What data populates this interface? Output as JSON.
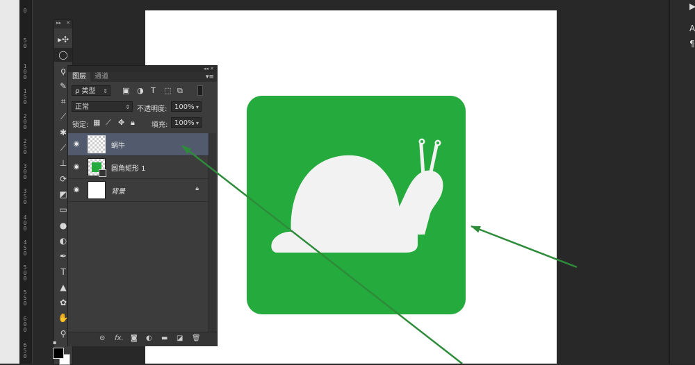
{
  "ruler": {
    "labels": [
      "0",
      "5\n0",
      "1\n0\n0",
      "1\n5\n0",
      "2\n0\n0",
      "2\n5\n0",
      "3\n0\n0",
      "3\n5\n0",
      "4\n0\n0",
      "4\n5\n0",
      "5\n0\n0",
      "5\n5\n0",
      "6\n0\n0",
      "6\n5\n0"
    ]
  },
  "toolbar": {
    "header_left": "▸▸",
    "header_right": "✕",
    "tools": [
      {
        "name": "move-tool-icon",
        "glyph": "▸✣"
      },
      {
        "name": "ellipse-marquee-tool-icon",
        "glyph": "◯"
      },
      {
        "name": "lasso-tool-icon",
        "glyph": "ϙ"
      },
      {
        "name": "quick-selection-tool-icon",
        "glyph": "✎"
      },
      {
        "name": "crop-tool-icon",
        "glyph": "⌗"
      },
      {
        "name": "eyedropper-tool-icon",
        "glyph": "⟋"
      },
      {
        "name": "healing-brush-tool-icon",
        "glyph": "✱"
      },
      {
        "name": "brush-tool-icon",
        "glyph": "⟋"
      },
      {
        "name": "clone-stamp-tool-icon",
        "glyph": "⊥"
      },
      {
        "name": "history-brush-tool-icon",
        "glyph": "⟳"
      },
      {
        "name": "eraser-tool-icon",
        "glyph": "◩"
      },
      {
        "name": "gradient-tool-icon",
        "glyph": "▭"
      },
      {
        "name": "blur-tool-icon",
        "glyph": "●"
      },
      {
        "name": "dodge-tool-icon",
        "glyph": "◐"
      },
      {
        "name": "pen-tool-icon",
        "glyph": "✒"
      },
      {
        "name": "type-tool-icon",
        "glyph": "T"
      },
      {
        "name": "path-selection-tool-icon",
        "glyph": "▲"
      },
      {
        "name": "custom-shape-tool-icon",
        "glyph": "✿"
      },
      {
        "name": "hand-tool-icon",
        "glyph": "✋"
      },
      {
        "name": "zoom-tool-icon",
        "glyph": "⚲"
      }
    ]
  },
  "layers_panel": {
    "top_controls": "◂◂ ✕",
    "tabs": [
      "图层",
      "通道"
    ],
    "menu_icon": "▾≡",
    "filter": {
      "value": "ρ 类型"
    },
    "blend_mode": {
      "value": "正常"
    },
    "opacity": {
      "label": "不透明度:",
      "value": "100%"
    },
    "lock": {
      "label": "锁定:"
    },
    "fill": {
      "label": "填充:",
      "value": "100%"
    },
    "layers": [
      {
        "name": "蜗牛",
        "selected": true
      },
      {
        "name": "圆角矩形 1",
        "selected": false
      },
      {
        "name": "背景",
        "selected": false,
        "locked": true
      }
    ],
    "bottom_icons": [
      "link-icon",
      "fx-icon",
      "mask-icon",
      "adjustment-icon",
      "folder-icon",
      "new-layer-icon",
      "trash-icon"
    ],
    "fx_label": "fx."
  },
  "right_panel": {
    "items": [
      "▶",
      "A",
      "¶"
    ]
  },
  "colors": {
    "green": "#25ab3d",
    "snail": "#f2f2f2",
    "arrow": "#2e8b3a",
    "selected_row": "#515b6d"
  }
}
